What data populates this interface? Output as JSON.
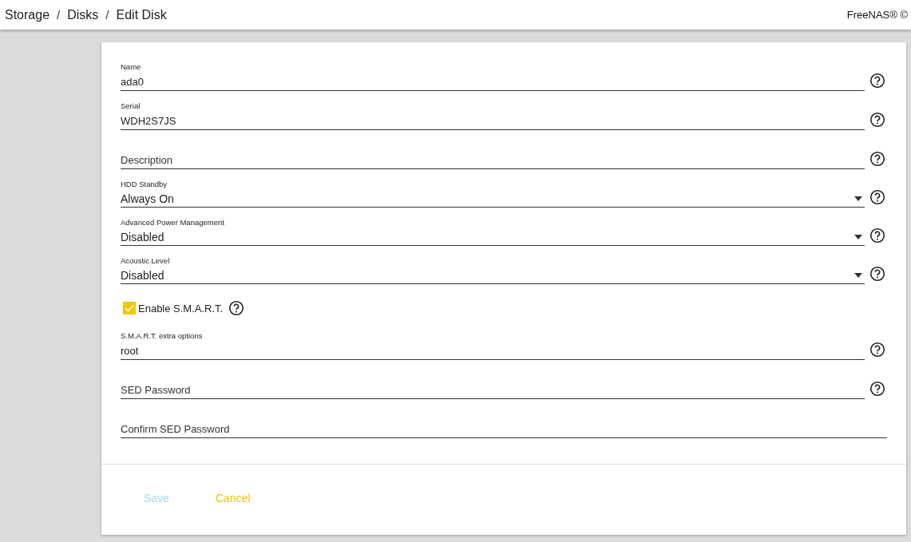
{
  "topbar": {
    "breadcrumbs": [
      "Storage",
      "Disks",
      "Edit Disk"
    ],
    "separator": "/",
    "brand": "FreeNAS® ©"
  },
  "fields": [
    {
      "kind": "text",
      "label": "Name",
      "value": "ada0",
      "has_help": true
    },
    {
      "kind": "text",
      "label": "Serial",
      "value": "WDH2S7JS",
      "has_help": true
    },
    {
      "kind": "text",
      "placeholder": "Description",
      "has_help": true
    },
    {
      "kind": "select",
      "label": "HDD Standby",
      "value": "Always On",
      "has_help": true
    },
    {
      "kind": "select",
      "label": "Advanced Power Management",
      "value": "Disabled",
      "has_help": true
    },
    {
      "kind": "select",
      "label": "Acoustic Level",
      "value": "Disabled",
      "has_help": true
    },
    {
      "kind": "checkbox",
      "label": "Enable S.M.A.R.T.",
      "checked": true,
      "has_help": true
    },
    {
      "kind": "text",
      "label": "S.M.A.R.T. extra options",
      "value": "root",
      "has_help": true
    },
    {
      "kind": "password",
      "placeholder": "SED Password",
      "has_help": true
    },
    {
      "kind": "password",
      "placeholder": "Confirm SED Password",
      "has_help": false
    }
  ],
  "actions": [
    {
      "label": "Save",
      "kind": "primary",
      "disabled": true
    },
    {
      "label": "Cancel",
      "kind": "secondary",
      "disabled": false
    }
  ]
}
